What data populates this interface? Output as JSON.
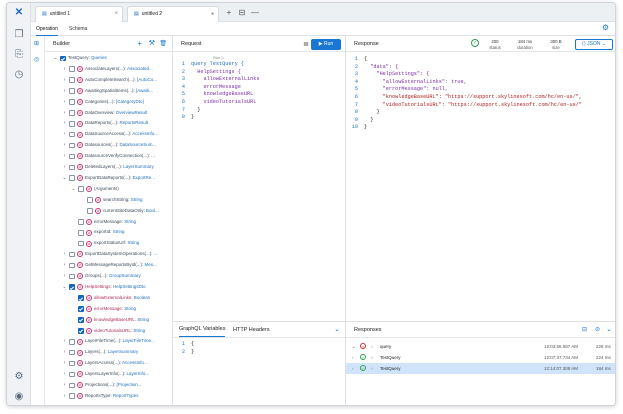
{
  "tabs": [
    {
      "label": "untitled 1"
    },
    {
      "label": "untitled 2"
    }
  ],
  "subtabs": {
    "operation": "Operation",
    "schema": "Schema"
  },
  "builder": {
    "title": "Builder"
  },
  "tree": [
    {
      "d": 0,
      "arrow": "⌄",
      "cb": "on",
      "icon": false,
      "name": "TestQuery:",
      "type": "Queries",
      "pink": false
    },
    {
      "d": 1,
      "arrow": "›",
      "cb": "off",
      "icon": true,
      "name": "AssociateLayers(...):",
      "type": "Associated...",
      "pink": false
    },
    {
      "d": 1,
      "arrow": "›",
      "cb": "off",
      "icon": true,
      "name": "AutoCompleteSearch(...):",
      "type": "[AutoCo...",
      "pink": false
    },
    {
      "d": 1,
      "arrow": "›",
      "cb": "off",
      "icon": true,
      "name": "AwaitingSpatialItems(...):",
      "type": "[Awaiti...",
      "pink": false
    },
    {
      "d": 1,
      "arrow": "›",
      "cb": "off",
      "icon": true,
      "name": "Categories(...):",
      "type": "[CategoryDto]",
      "pink": false
    },
    {
      "d": 1,
      "arrow": "›",
      "cb": "off",
      "icon": true,
      "name": "DataOverview:",
      "type": "OverviewResult",
      "pink": false
    },
    {
      "d": 1,
      "arrow": "›",
      "cb": "off",
      "icon": true,
      "name": "DataReports(...):",
      "type": "ReportsResult",
      "pink": false
    },
    {
      "d": 1,
      "arrow": "›",
      "cb": "off",
      "icon": true,
      "name": "DataSourceAccess(...):",
      "type": "AccessInfo...",
      "pink": false
    },
    {
      "d": 1,
      "arrow": "›",
      "cb": "off",
      "icon": true,
      "name": "Datasources(...):",
      "type": "DataSourceSum...",
      "pink": false
    },
    {
      "d": 1,
      "arrow": "›",
      "cb": "off",
      "icon": true,
      "name": "DatasourceVerifyConnection(...):",
      "type": "...",
      "pink": false
    },
    {
      "d": 1,
      "arrow": "›",
      "cb": "off",
      "icon": true,
      "name": "DeletedLayers(...):",
      "type": "LayerSummary",
      "pink": false
    },
    {
      "d": 1,
      "arrow": "⌄",
      "cb": "off",
      "icon": true,
      "name": "ExportDataReports(...):",
      "type": "ExportRe...",
      "pink": false
    },
    {
      "d": 2,
      "arrow": "⌄",
      "cb": "off",
      "icon": true,
      "name": "(Arguments)",
      "type": "",
      "pink": false
    },
    {
      "d": 3,
      "arrow": "",
      "cb": "off",
      "icon": true,
      "name": "searchString:",
      "type": "String",
      "pink": false
    },
    {
      "d": 3,
      "arrow": "",
      "cb": "off",
      "icon": true,
      "name": "currentSiteDataOnly:",
      "type": "Bool...",
      "pink": false
    },
    {
      "d": 2,
      "arrow": "",
      "cb": "off",
      "icon": true,
      "name": "errorMessage:",
      "type": "String",
      "pink": false
    },
    {
      "d": 2,
      "arrow": "",
      "cb": "off",
      "icon": true,
      "name": "exportId:",
      "type": "String",
      "pink": false
    },
    {
      "d": 2,
      "arrow": "",
      "cb": "off",
      "icon": true,
      "name": "exportStatusUrl:",
      "type": "String",
      "pink": false
    },
    {
      "d": 1,
      "arrow": "›",
      "cb": "off",
      "icon": true,
      "name": "ExportDataSystemOperations(...):",
      "type": "...",
      "pink": false
    },
    {
      "d": 1,
      "arrow": "›",
      "cb": "off",
      "icon": true,
      "name": "GetMessageReportsById(...):",
      "type": "Mes...",
      "pink": false
    },
    {
      "d": 1,
      "arrow": "›",
      "cb": "off",
      "icon": true,
      "name": "Groups(...):",
      "type": "GroupSummary",
      "pink": false
    },
    {
      "d": 1,
      "arrow": "⌄",
      "cb": "on",
      "icon": true,
      "name": "HelpSettings:",
      "type": "HelpSettingsDto",
      "pink": true
    },
    {
      "d": 2,
      "arrow": "",
      "cb": "on",
      "icon": true,
      "name": "allowExternalLinks:",
      "type": "Boolean",
      "pink": true
    },
    {
      "d": 2,
      "arrow": "",
      "cb": "on",
      "icon": true,
      "name": "errorMessage:",
      "type": "String",
      "pink": true
    },
    {
      "d": 2,
      "arrow": "",
      "cb": "on",
      "icon": true,
      "name": "knowledgeBaseURL:",
      "type": "String",
      "pink": true
    },
    {
      "d": 2,
      "arrow": "",
      "cb": "on",
      "icon": true,
      "name": "videoTutorialsURL:",
      "type": "String",
      "pink": true
    },
    {
      "d": 1,
      "arrow": "›",
      "cb": "off",
      "icon": true,
      "name": "LayerFileTime(...):",
      "type": "LayerFileTime...",
      "pink": false
    },
    {
      "d": 1,
      "arrow": "›",
      "cb": "off",
      "icon": true,
      "name": "Layers(...):",
      "type": "LayerSummary",
      "pink": false
    },
    {
      "d": 1,
      "arrow": "›",
      "cb": "off",
      "icon": true,
      "name": "LayersAccess(...):",
      "type": "AccessInfo...",
      "pink": false
    },
    {
      "d": 1,
      "arrow": "›",
      "cb": "off",
      "icon": true,
      "name": "LayersLayerInfo(...):",
      "type": "LayerInfo...",
      "pink": false
    },
    {
      "d": 1,
      "arrow": "›",
      "cb": "off",
      "icon": true,
      "name": "Projections(...):",
      "type": "[Projection...",
      "pink": false
    },
    {
      "d": 1,
      "arrow": "›",
      "cb": "off",
      "icon": true,
      "name": "ReportsType:",
      "type": "ReportTypes",
      "pink": false
    }
  ],
  "request": {
    "title": "Request",
    "run_label": "Run",
    "run_hint": "Run ▷",
    "lines": [
      "query TestQuery {",
      "  HelpSettings {",
      "    allowExternalLinks",
      "    errorMessage",
      "    knowledgeBaseURL",
      "    videoTutorialsURL",
      "  }",
      "}"
    ]
  },
  "response": {
    "title": "Response",
    "status_value": "200",
    "status_label": "status",
    "duration_value": "184 ms",
    "duration_label": "duration",
    "size_value": "300 B",
    "size_label": "size",
    "format": "JSON",
    "lines": [
      "{",
      "  \"data\": {",
      "    \"HelpSettings\": {",
      "      \"allowExternalLinks\": true,",
      "      \"errorMessage\": null,",
      "      \"knowledgeBaseURL\": \"https://support.skylinesoft.com/hc/en-us/\",",
      "      \"videoTutorialsURL\": \"https://support.skylinesoft.com/hc/en-us/\"",
      "    }",
      "  }",
      "}"
    ]
  },
  "variables": {
    "tab_vars": "GraphQL Variables",
    "tab_headers": "HTTP Headers",
    "lines": [
      "{",
      "}"
    ]
  },
  "responses": {
    "title": "Responses",
    "rows": [
      {
        "name": "query",
        "time": "12:03:56.587 AM",
        "dur": "228 ms",
        "ok": false,
        "expanded": true
      },
      {
        "name": "TestQuery",
        "time": "12:07:37.734 AM",
        "dur": "224 ms",
        "ok": true,
        "expanded": false
      },
      {
        "name": "TestQuery",
        "time": "12:14:07.308 AM",
        "dur": "184 ms",
        "ok": true,
        "expanded": false
      }
    ]
  },
  "colors": {
    "accent": "#1976d2",
    "error": "#d32f2f",
    "success": "#2e9e4f"
  }
}
